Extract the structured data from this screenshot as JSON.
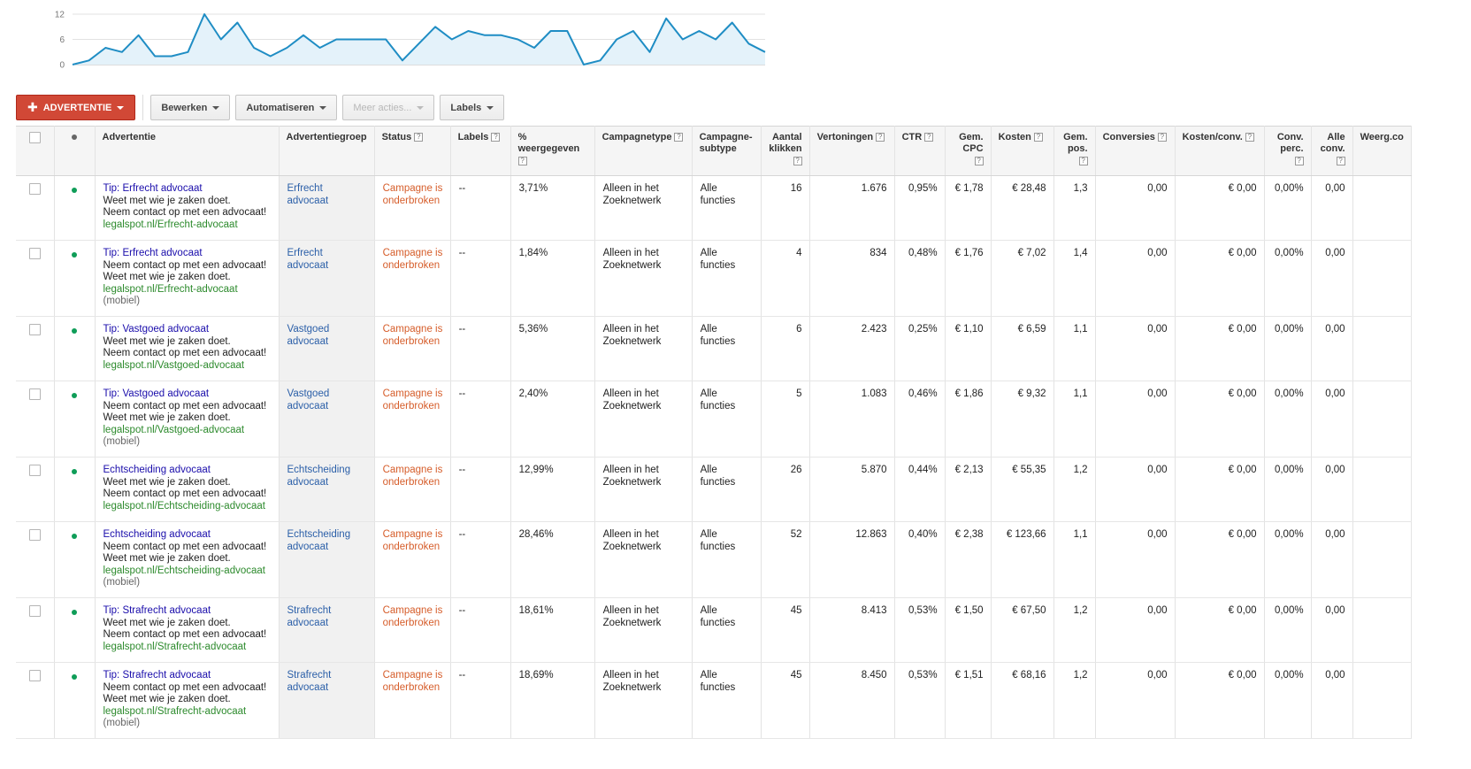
{
  "chart": {
    "y_ticks": [
      "12",
      "6",
      "0"
    ],
    "line_color": "#1f8dc4",
    "fill_color": "#e4f2fa"
  },
  "chart_data": {
    "type": "area",
    "ylim": [
      0,
      12
    ],
    "values": [
      0,
      1,
      4,
      3,
      7,
      2,
      2,
      3,
      12,
      6,
      10,
      4,
      2,
      4,
      7,
      4,
      6,
      6,
      6,
      6,
      1,
      5,
      9,
      6,
      8,
      7,
      7,
      6,
      4,
      8,
      8,
      0,
      1,
      6,
      8,
      3,
      11,
      6,
      8,
      6,
      10,
      5,
      3
    ]
  },
  "toolbar": {
    "add_label": "ADVERTENTIE",
    "edit_label": "Bewerken",
    "automate_label": "Automatiseren",
    "more_label": "Meer acties...",
    "labels_label": "Labels"
  },
  "columns": {
    "ad": "Advertentie",
    "adgroup": "Advertentiegroep",
    "status": "Status",
    "labels": "Labels",
    "pct_shown": "% weergegeven",
    "campaign_type": "Campagnetype",
    "campaign_subtype": "Campagne-subtype",
    "clicks": "Aantal klikken",
    "impressions": "Vertoningen",
    "ctr": "CTR",
    "avg_cpc": "Gem. CPC",
    "cost": "Kosten",
    "avg_pos": "Gem. pos.",
    "conversions": "Conversies",
    "cost_conv": "Kosten/conv.",
    "conv_rate": "Conv. perc.",
    "all_conv": "Alle conv.",
    "view_conv": "Weerg.co"
  },
  "rows": [
    {
      "title": "Tip: Erfrecht advocaat",
      "line1": "Weet met wie je zaken doet.",
      "line2": "Neem contact op met een advocaat!",
      "url": "legalspot.nl/Erfrecht-advocaat",
      "device": "",
      "adgroup": "Erfrecht advocaat",
      "status": "Campagne is onderbroken",
      "labels": "--",
      "pct": "3,71%",
      "ctype": "Alleen in het Zoeknetwerk",
      "csub": "Alle functies",
      "clicks": "16",
      "impr": "1.676",
      "ctr": "0,95%",
      "cpc": "€ 1,78",
      "cost": "€ 28,48",
      "pos": "1,3",
      "conv": "0,00",
      "costconv": "€ 0,00",
      "convrate": "0,00%",
      "allconv": "0,00"
    },
    {
      "title": "Tip: Erfrecht advocaat",
      "line1": "Neem contact op met een advocaat!",
      "line2": "Weet met wie je zaken doet.",
      "url": "legalspot.nl/Erfrecht-advocaat",
      "device": "(mobiel)",
      "adgroup": "Erfrecht advocaat",
      "status": "Campagne is onderbroken",
      "labels": "--",
      "pct": "1,84%",
      "ctype": "Alleen in het Zoeknetwerk",
      "csub": "Alle functies",
      "clicks": "4",
      "impr": "834",
      "ctr": "0,48%",
      "cpc": "€ 1,76",
      "cost": "€ 7,02",
      "pos": "1,4",
      "conv": "0,00",
      "costconv": "€ 0,00",
      "convrate": "0,00%",
      "allconv": "0,00"
    },
    {
      "title": "Tip: Vastgoed advocaat",
      "line1": "Weet met wie je zaken doet.",
      "line2": "Neem contact op met een advocaat!",
      "url": "legalspot.nl/Vastgoed-advocaat",
      "device": "",
      "adgroup": "Vastgoed advocaat",
      "status": "Campagne is onderbroken",
      "labels": "--",
      "pct": "5,36%",
      "ctype": "Alleen in het Zoeknetwerk",
      "csub": "Alle functies",
      "clicks": "6",
      "impr": "2.423",
      "ctr": "0,25%",
      "cpc": "€ 1,10",
      "cost": "€ 6,59",
      "pos": "1,1",
      "conv": "0,00",
      "costconv": "€ 0,00",
      "convrate": "0,00%",
      "allconv": "0,00"
    },
    {
      "title": "Tip: Vastgoed advocaat",
      "line1": "Neem contact op met een advocaat!",
      "line2": "Weet met wie je zaken doet.",
      "url": "legalspot.nl/Vastgoed-advocaat",
      "device": "(mobiel)",
      "adgroup": "Vastgoed advocaat",
      "status": "Campagne is onderbroken",
      "labels": "--",
      "pct": "2,40%",
      "ctype": "Alleen in het Zoeknetwerk",
      "csub": "Alle functies",
      "clicks": "5",
      "impr": "1.083",
      "ctr": "0,46%",
      "cpc": "€ 1,86",
      "cost": "€ 9,32",
      "pos": "1,1",
      "conv": "0,00",
      "costconv": "€ 0,00",
      "convrate": "0,00%",
      "allconv": "0,00"
    },
    {
      "title": "Echtscheiding advocaat",
      "line1": "Weet met wie je zaken doet.",
      "line2": "Neem contact op met een advocaat!",
      "url": "legalspot.nl/Echtscheiding-advocaat",
      "device": "",
      "adgroup": "Echtscheiding advocaat",
      "status": "Campagne is onderbroken",
      "labels": "--",
      "pct": "12,99%",
      "ctype": "Alleen in het Zoeknetwerk",
      "csub": "Alle functies",
      "clicks": "26",
      "impr": "5.870",
      "ctr": "0,44%",
      "cpc": "€ 2,13",
      "cost": "€ 55,35",
      "pos": "1,2",
      "conv": "0,00",
      "costconv": "€ 0,00",
      "convrate": "0,00%",
      "allconv": "0,00"
    },
    {
      "title": "Echtscheiding advocaat",
      "line1": "Neem contact op met een advocaat!",
      "line2": "Weet met wie je zaken doet.",
      "url": "legalspot.nl/Echtscheiding-advocaat",
      "device": "(mobiel)",
      "adgroup": "Echtscheiding advocaat",
      "status": "Campagne is onderbroken",
      "labels": "--",
      "pct": "28,46%",
      "ctype": "Alleen in het Zoeknetwerk",
      "csub": "Alle functies",
      "clicks": "52",
      "impr": "12.863",
      "ctr": "0,40%",
      "cpc": "€ 2,38",
      "cost": "€ 123,66",
      "pos": "1,1",
      "conv": "0,00",
      "costconv": "€ 0,00",
      "convrate": "0,00%",
      "allconv": "0,00"
    },
    {
      "title": "Tip: Strafrecht advocaat",
      "line1": "Weet met wie je zaken doet.",
      "line2": "Neem contact op met een advocaat!",
      "url": "legalspot.nl/Strafrecht-advocaat",
      "device": "",
      "adgroup": "Strafrecht advocaat",
      "status": "Campagne is onderbroken",
      "labels": "--",
      "pct": "18,61%",
      "ctype": "Alleen in het Zoeknetwerk",
      "csub": "Alle functies",
      "clicks": "45",
      "impr": "8.413",
      "ctr": "0,53%",
      "cpc": "€ 1,50",
      "cost": "€ 67,50",
      "pos": "1,2",
      "conv": "0,00",
      "costconv": "€ 0,00",
      "convrate": "0,00%",
      "allconv": "0,00"
    },
    {
      "title": "Tip: Strafrecht advocaat",
      "line1": "Neem contact op met een advocaat!",
      "line2": "Weet met wie je zaken doet.",
      "url": "legalspot.nl/Strafrecht-advocaat",
      "device": "(mobiel)",
      "adgroup": "Strafrecht advocaat",
      "status": "Campagne is onderbroken",
      "labels": "--",
      "pct": "18,69%",
      "ctype": "Alleen in het Zoeknetwerk",
      "csub": "Alle functies",
      "clicks": "45",
      "impr": "8.450",
      "ctr": "0,53%",
      "cpc": "€ 1,51",
      "cost": "€ 68,16",
      "pos": "1,2",
      "conv": "0,00",
      "costconv": "€ 0,00",
      "convrate": "0,00%",
      "allconv": "0,00"
    }
  ]
}
